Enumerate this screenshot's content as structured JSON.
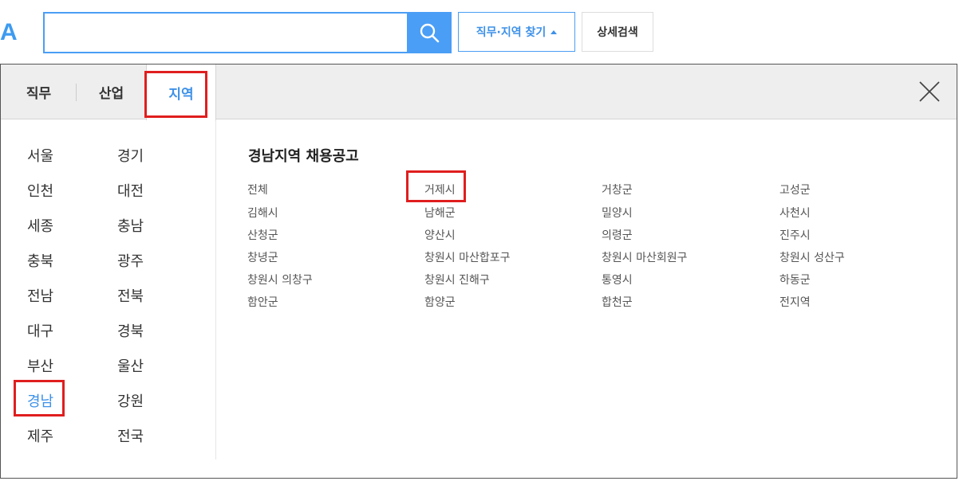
{
  "logo_text": "A",
  "search": {
    "value": "",
    "placeholder": ""
  },
  "buttons": {
    "job_region": "직무·지역 찾기",
    "advanced": "상세검색"
  },
  "tabs": [
    "직무",
    "산업",
    "지역"
  ],
  "active_tab": "지역",
  "regions": [
    "서울",
    "경기",
    "인천",
    "대전",
    "세종",
    "충남",
    "충북",
    "광주",
    "전남",
    "전북",
    "대구",
    "경북",
    "부산",
    "울산",
    "경남",
    "강원",
    "제주",
    "전국"
  ],
  "active_region": "경남",
  "subregion_title": "경남지역 채용공고",
  "subregions": [
    "전체",
    "거제시",
    "거창군",
    "고성군",
    "김해시",
    "남해군",
    "밀양시",
    "사천시",
    "산청군",
    "양산시",
    "의령군",
    "진주시",
    "창녕군",
    "창원시 마산합포구",
    "창원시 마산회원구",
    "창원시 성산구",
    "창원시 의창구",
    "창원시 진해구",
    "통영시",
    "하동군",
    "함안군",
    "함양군",
    "합천군",
    "전지역"
  ],
  "highlighted_subregion": "거제시",
  "colors": {
    "accent": "#3d91e8",
    "search_border": "#4a9ef5",
    "highlight": "#e01e1e"
  },
  "icons": {
    "search": "search-icon",
    "caret": "caret-up-icon",
    "close": "close-icon"
  }
}
